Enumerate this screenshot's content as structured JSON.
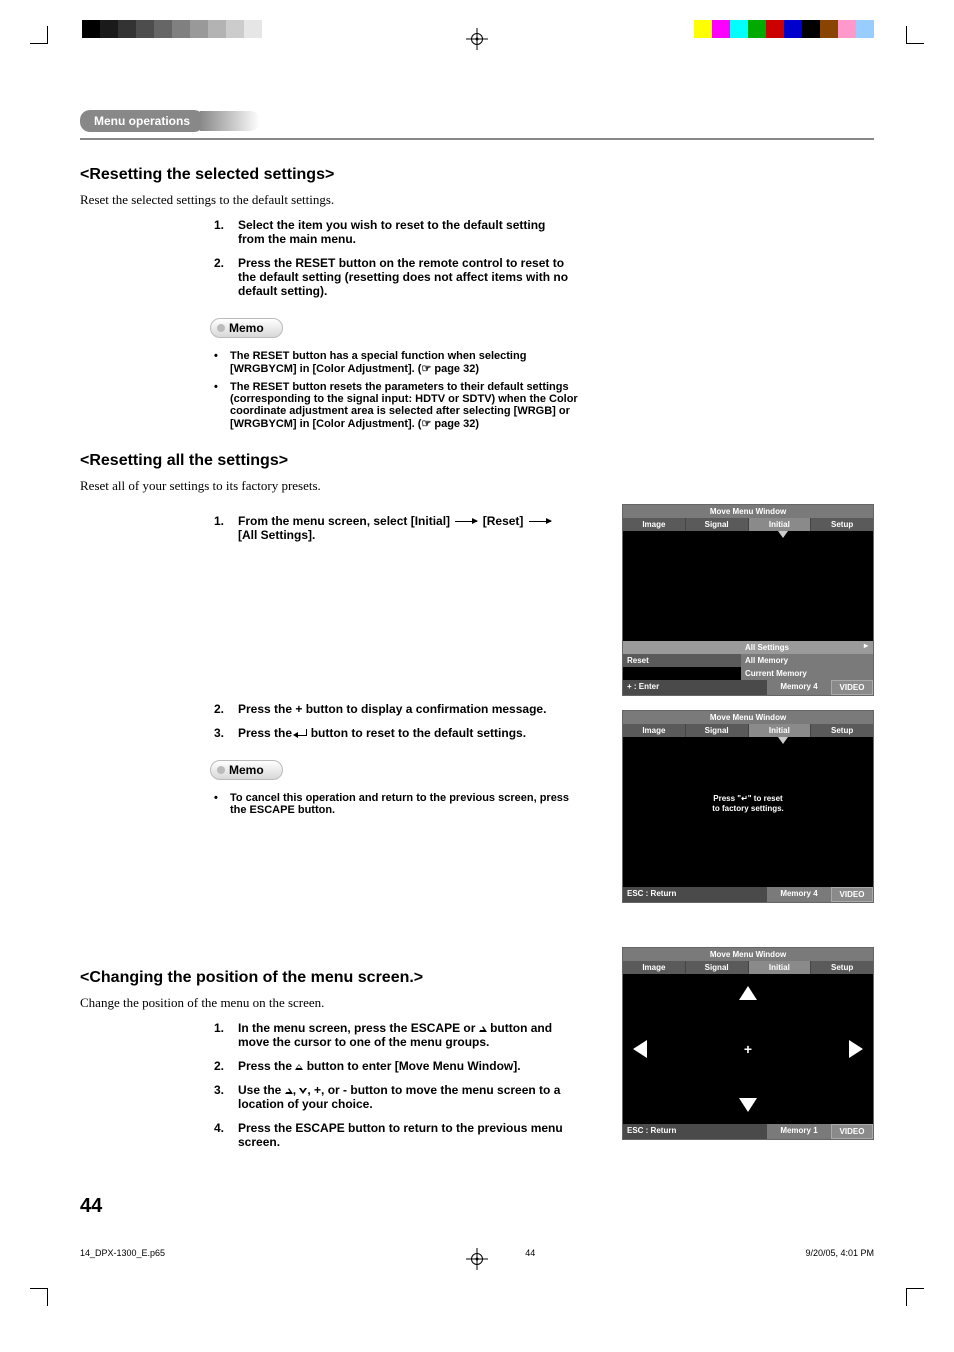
{
  "header": {
    "breadcrumb": "Menu operations"
  },
  "section1": {
    "title": "<Resetting the selected settings>",
    "intro": "Reset the selected settings to the default settings.",
    "steps": [
      {
        "num": "1.",
        "text": "Select the item you wish to reset to the default setting from the main menu."
      },
      {
        "num": "2.",
        "text": "Press the RESET button on the remote control to reset to the default setting (resetting does not affect items with no default setting)."
      }
    ],
    "memo_label": "Memo",
    "memo": [
      "The RESET button has a special function when selecting [WRGBYCM] in [Color Adjustment]. (☞ page 32)",
      "The RESET button resets the parameters to their default settings (corresponding to the signal input: HDTV or SDTV) when the Color coordinate adjustment area is selected after selecting  [WRGB] or [WRGBYCM] in [Color Adjustment]. (☞ page 32)"
    ]
  },
  "section2": {
    "title": "<Resetting all the settings>",
    "intro": "Reset all of your settings to its factory presets.",
    "steps": [
      {
        "num": "1.",
        "pre": "From the menu screen, select [Initial]",
        "mid": "[Reset]",
        "post": "[All Settings]."
      },
      {
        "num": "2.",
        "text": "Press the + button to display a confirmation message."
      },
      {
        "num": "3.",
        "pre": "Press the ",
        "post": " button to reset to the default settings."
      }
    ],
    "memo_label": "Memo",
    "memo": [
      "To cancel this operation and return to the previous screen, press the ESCAPE button."
    ]
  },
  "section3": {
    "title": "<Changing the position of the menu screen.>",
    "intro": "Change the position of the menu on the screen.",
    "steps": [
      {
        "num": "1.",
        "pre": "In the menu screen, press the ESCAPE or ",
        "post": " button and move the cursor to one of the menu groups."
      },
      {
        "num": "2.",
        "pre": "Press the ",
        "post": " button to enter [Move Menu Window]."
      },
      {
        "num": "3.",
        "pre": "Use the ",
        "mid": ", ",
        "mid2": ", +, or - button to move the menu screen to a location of your choice."
      },
      {
        "num": "4.",
        "text": "Press the ESCAPE button to return to the previous menu screen."
      }
    ]
  },
  "osd": {
    "title": "Move Menu Window",
    "tabs": [
      "Image",
      "Signal",
      "Initial",
      "Setup"
    ],
    "reset_row": "Reset",
    "options": [
      "All Settings",
      "All Memory",
      "Current Memory"
    ],
    "footer1": {
      "left": "+ : Enter",
      "mid": "Memory 4",
      "right": "VIDEO"
    },
    "confirm_line1": "Press \"↵\" to reset",
    "confirm_line2": "to factory settings.",
    "footer2": {
      "left": "ESC : Return",
      "mid": "Memory 4",
      "right": "VIDEO"
    },
    "footer3": {
      "left": "ESC : Return",
      "mid": "Memory 1",
      "right": "VIDEO"
    }
  },
  "page_number": "44",
  "footer": {
    "file": "14_DPX-1300_E.p65",
    "page": "44",
    "date": "9/20/05, 4:01 PM"
  }
}
